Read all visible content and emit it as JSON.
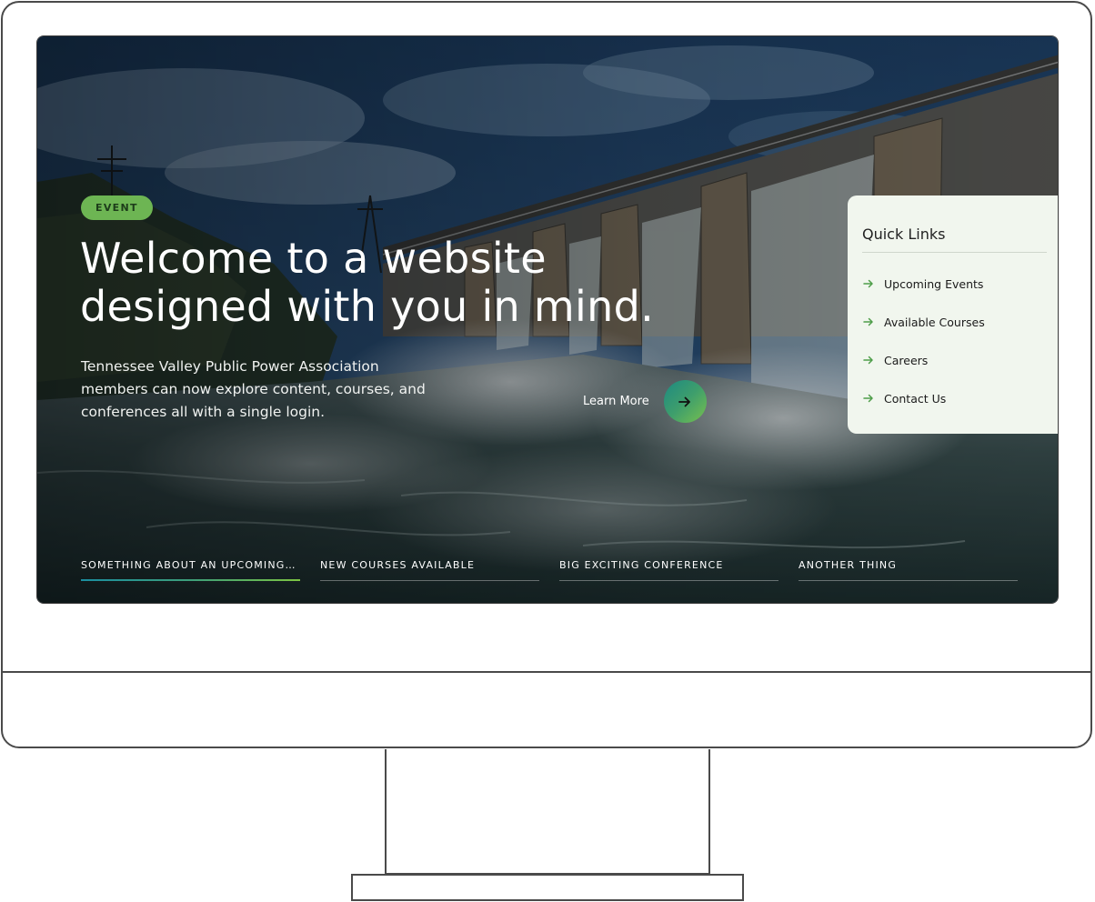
{
  "hero": {
    "badge": "EVENT",
    "headline_line1": "Welcome to a website",
    "headline_line2": "designed with you in mind.",
    "description": "Tennessee Valley Public Power Association members can now explore content, courses, and conferences all with a single login.",
    "cta_label": "Learn More"
  },
  "quick_links": {
    "title": "Quick Links",
    "items": [
      {
        "label": "Upcoming Events"
      },
      {
        "label": "Available Courses"
      },
      {
        "label": "Careers"
      },
      {
        "label": "Contact Us"
      }
    ]
  },
  "tabs": [
    {
      "label": "SOMETHING ABOUT AN UPCOMING EVENT",
      "active": true
    },
    {
      "label": "NEW COURSES AVAILABLE",
      "active": false
    },
    {
      "label": "BIG EXCITING CONFERENCE",
      "active": false
    },
    {
      "label": "ANOTHER THING",
      "active": false
    }
  ],
  "colors": {
    "badge": "#6db553",
    "panel_bg": "#f1f6ee",
    "accent_teal": "#1d8a82",
    "accent_green": "#78c04e"
  },
  "icons": {
    "cta": "arrow-right-icon",
    "quick_link": "arrow-right-icon"
  }
}
